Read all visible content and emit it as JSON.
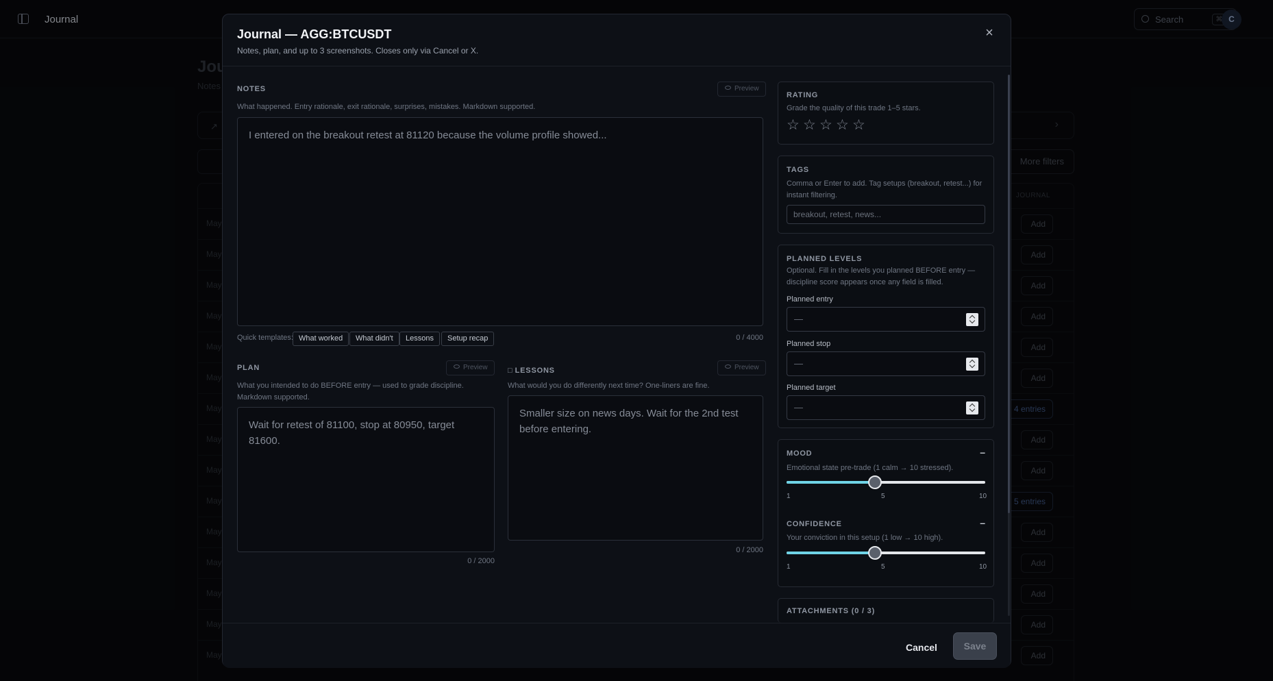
{
  "app": {
    "title": "Journal",
    "search_label": "Search",
    "search_kbd": "⌘K",
    "avatar_initial": "C"
  },
  "background": {
    "page_title": "Jou",
    "page_subtitle": "Notes",
    "more_filters": "More filters",
    "col_head": "JOURNAL",
    "rows": [
      {
        "date": "May",
        "action": "Add"
      },
      {
        "date": "May",
        "action": "Add"
      },
      {
        "date": "May",
        "action": "Add"
      },
      {
        "date": "May",
        "action": "Add"
      },
      {
        "date": "May",
        "action": "Add"
      },
      {
        "date": "May",
        "action": "Add"
      },
      {
        "date": "May",
        "action": "4 entries"
      },
      {
        "date": "May",
        "action": "Add"
      },
      {
        "date": "May",
        "action": "Add"
      },
      {
        "date": "May",
        "action": "5 entries"
      },
      {
        "date": "May",
        "action": "Add"
      },
      {
        "date": "May",
        "action": "Add"
      },
      {
        "date": "May",
        "action": "Add"
      },
      {
        "date": "May",
        "action": "Add"
      },
      {
        "date": "May",
        "action": "Add"
      }
    ]
  },
  "modal": {
    "title": "Journal — AGG:BTCUSDT",
    "subtitle": "Notes, plan, and up to 3 screenshots. Closes only via Cancel or X.",
    "close_label": "×",
    "notes": {
      "label": "NOTES",
      "help": "What happened. Entry rationale, exit rationale, surprises, mistakes. Markdown supported.",
      "preview": "Preview",
      "placeholder": "I entered on the breakout retest at 81120 because the volume profile showed...",
      "counter": "0 / 4000"
    },
    "templates": {
      "label": "Quick templates:",
      "items": [
        "What worked",
        "What didn't",
        "Lessons",
        "Setup recap"
      ]
    },
    "plan": {
      "label": "PLAN",
      "help": "What you intended to do BEFORE entry — used to grade discipline. Markdown supported.",
      "preview": "Preview",
      "placeholder": "Wait for retest of 81100, stop at 80950, target 81600.",
      "counter": "0 / 2000"
    },
    "lessons": {
      "label": "LESSONS",
      "help": "What would you do differently next time? One-liners are fine.",
      "preview": "Preview",
      "placeholder": "Smaller size on news days. Wait for the 2nd test before entering.",
      "counter": "0 / 2000"
    },
    "rating": {
      "label": "RATING",
      "help": "Grade the quality of this trade 1–5 stars.",
      "stars": [
        "☆",
        "☆",
        "☆",
        "☆",
        "☆"
      ],
      "value": 0,
      "max": 5
    },
    "tags": {
      "label": "TAGS",
      "help": "Comma or Enter to add. Tag setups (breakout, retest...) for instant filtering.",
      "placeholder": "breakout, retest, news..."
    },
    "planned_levels": {
      "label": "PLANNED LEVELS",
      "help": "Optional. Fill in the levels you planned BEFORE entry — discipline score appears once any field is filled.",
      "entry_label": "Planned entry",
      "stop_label": "Planned stop",
      "target_label": "Planned target",
      "empty": "—"
    },
    "mood": {
      "label": "MOOD",
      "dash": "–",
      "help": "Emotional state pre-trade (1 calm → 10 stressed).",
      "min": 1,
      "mid": 5,
      "max": 10,
      "value": 5,
      "tick_min": "1",
      "tick_mid": "5",
      "tick_max": "10"
    },
    "confidence": {
      "label": "CONFIDENCE",
      "dash": "–",
      "help": "Your conviction in this setup (1 low → 10 high).",
      "min": 1,
      "mid": 5,
      "max": 10,
      "value": 5,
      "tick_min": "1",
      "tick_mid": "5",
      "tick_max": "10"
    },
    "attachments": {
      "label": "ATTACHMENTS (0 / 3)"
    },
    "footer": {
      "cancel": "Cancel",
      "save": "Save"
    }
  },
  "colors": {
    "accent_slider": "#6fd3e6",
    "background": "#08090c",
    "modal": "#0d1016"
  }
}
